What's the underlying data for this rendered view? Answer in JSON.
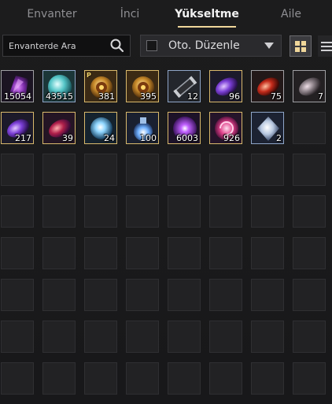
{
  "tabs": [
    {
      "label": "Envanter"
    },
    {
      "label": "İnci"
    },
    {
      "label": "Yükseltme"
    },
    {
      "label": "Aile"
    }
  ],
  "search": {
    "placeholder": "Envanterde Ara"
  },
  "auto_sort": {
    "label": "Oto. Düzenle",
    "checked": false
  },
  "view_modes": {
    "grid": "grid-icon",
    "list": "list-icon"
  },
  "colors": {
    "accent": "#f0d79a",
    "gold_border": "#d9b96c",
    "blue_border": "#8fa6c8"
  },
  "items": [
    {
      "icon": "dark-crystal-icon",
      "count": "15054"
    },
    {
      "icon": "teal-gem-icon",
      "count": "43515"
    },
    {
      "icon": "gold-ornament-icon",
      "count": "381",
      "badge": "P"
    },
    {
      "icon": "gold-ornament-icon",
      "count": "395"
    },
    {
      "icon": "scroll-icon",
      "count": "12"
    },
    {
      "icon": "purple-stone-icon",
      "count": "96"
    },
    {
      "icon": "red-stone-icon",
      "count": "75"
    },
    {
      "icon": "grey-stone-icon",
      "count": "7"
    },
    {
      "icon": "purple-stone-icon",
      "count": "217"
    },
    {
      "icon": "red-purple-stone-icon",
      "count": "39"
    },
    {
      "icon": "blue-orb-icon",
      "count": "24"
    },
    {
      "icon": "blue-flask-icon",
      "count": "100"
    },
    {
      "icon": "purple-orb-icon",
      "count": "6003"
    },
    {
      "icon": "pink-swirl-icon",
      "count": "926"
    },
    {
      "icon": "silver-crystal-icon",
      "count": "2"
    }
  ]
}
